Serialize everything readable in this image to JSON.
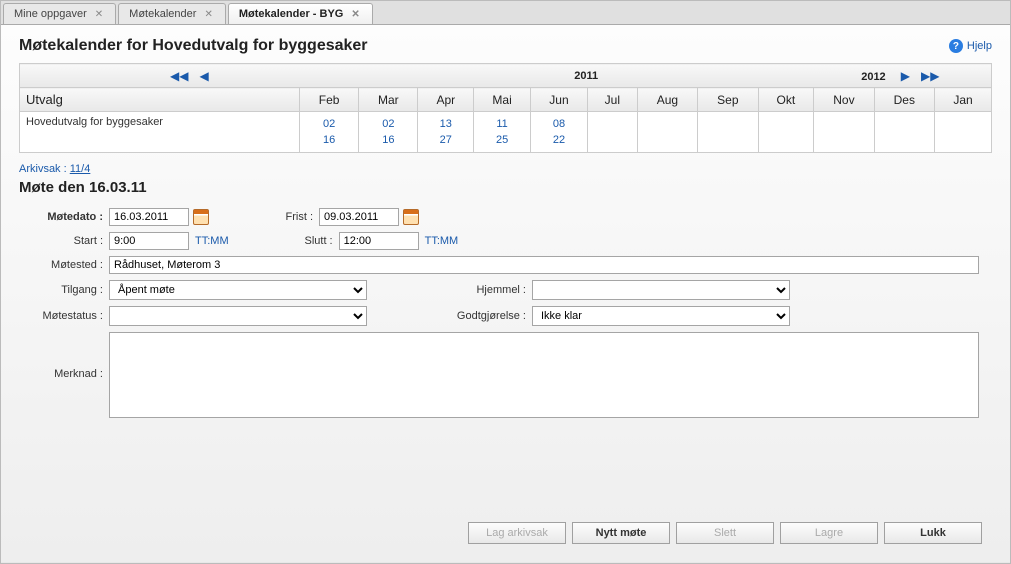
{
  "tabs": [
    {
      "label": "Mine oppgaver"
    },
    {
      "label": "Møtekalender"
    },
    {
      "label": "Møtekalender - BYG"
    }
  ],
  "help": {
    "label": "Hjelp"
  },
  "page_title": "Møtekalender for Hovedutvalg for byggesaker",
  "calendar": {
    "year_main": "2011",
    "year_next": "2012",
    "utvalg_header": "Utvalg",
    "months": [
      "Feb",
      "Mar",
      "Apr",
      "Mai",
      "Jun",
      "Jul",
      "Aug",
      "Sep",
      "Okt",
      "Nov",
      "Des",
      "Jan"
    ],
    "row": {
      "name": "Hovedutvalg for byggesaker",
      "dates": {
        "Feb": [
          "02",
          "16"
        ],
        "Mar": [
          "02",
          "16"
        ],
        "Apr": [
          "13",
          "27"
        ],
        "Mai": [
          "11",
          "25"
        ],
        "Jun": [
          "08",
          "22"
        ],
        "Jul": [],
        "Aug": [],
        "Sep": [],
        "Okt": [],
        "Nov": [],
        "Des": [],
        "Jan": []
      }
    }
  },
  "arkiv": {
    "label": "Arkivsak : ",
    "value": "11/4"
  },
  "meeting_title": "Møte den 16.03.11",
  "form": {
    "motedato": {
      "label": "Møtedato :",
      "value": "16.03.2011"
    },
    "frist": {
      "label": "Frist :",
      "value": "09.03.2011"
    },
    "start": {
      "label": "Start :",
      "value": "9:00",
      "hint": "TT:MM"
    },
    "slutt": {
      "label": "Slutt :",
      "value": "12:00",
      "hint": "TT:MM"
    },
    "motested": {
      "label": "Møtested :",
      "value": "Rådhuset, Møterom 3"
    },
    "tilgang": {
      "label": "Tilgang :",
      "value": "Åpent møte"
    },
    "hjemmel": {
      "label": "Hjemmel :",
      "value": ""
    },
    "motestatus": {
      "label": "Møtestatus :",
      "value": ""
    },
    "godtgjorelse": {
      "label": "Godtgjørelse :",
      "value": "Ikke klar"
    },
    "merknad": {
      "label": "Merknad :",
      "value": ""
    }
  },
  "buttons": {
    "lag_arkivsak": "Lag arkivsak",
    "nytt_mote": "Nytt møte",
    "slett": "Slett",
    "lagre": "Lagre",
    "lukk": "Lukk"
  }
}
